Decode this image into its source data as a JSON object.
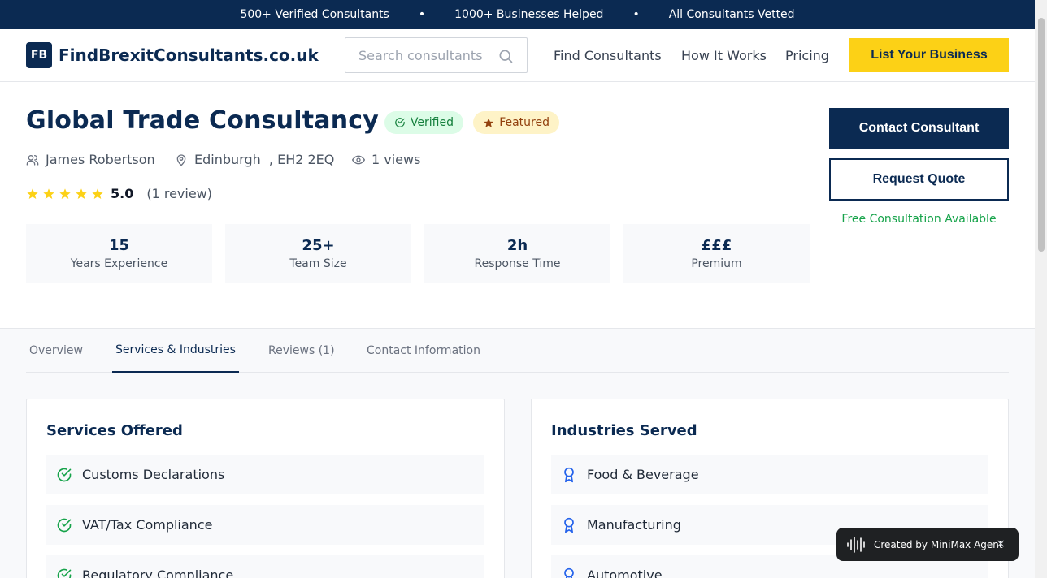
{
  "topbar": {
    "items": [
      "500+ Verified Consultants",
      "1000+ Businesses Helped",
      "All Consultants Vetted"
    ],
    "separator": "•"
  },
  "header": {
    "logo_badge": "FB",
    "logo_text": "FindBrexitConsultants.co.uk",
    "search_placeholder": "Search consultants",
    "nav": [
      "Find Consultants",
      "How It Works",
      "Pricing"
    ],
    "cta": "List Your Business"
  },
  "profile": {
    "name": "Global Trade Consultancy",
    "badge_verified": "Verified",
    "badge_featured": "Featured",
    "person": "James Robertson",
    "location": "Edinburgh  , EH2 2EQ",
    "views": "1 views",
    "rating": "5.0",
    "rating_stars": 5,
    "review_count": "(1 review)"
  },
  "stats": [
    {
      "value": "15",
      "label": "Years Experience"
    },
    {
      "value": "25+",
      "label": "Team Size"
    },
    {
      "value": "2h",
      "label": "Response Time"
    },
    {
      "value": "£££",
      "label": "Premium"
    }
  ],
  "actions": {
    "contact": "Contact Consultant",
    "quote": "Request Quote",
    "free_consultation": "Free Consultation Available"
  },
  "tabs": [
    {
      "label": "Overview",
      "active": false
    },
    {
      "label": "Services & Industries",
      "active": true
    },
    {
      "label": "Reviews (1)",
      "active": false
    },
    {
      "label": "Contact Information",
      "active": false
    }
  ],
  "services": {
    "title": "Services Offered",
    "items": [
      "Customs Declarations",
      "VAT/Tax Compliance",
      "Regulatory Compliance"
    ]
  },
  "industries": {
    "title": "Industries Served",
    "items": [
      "Food & Beverage",
      "Manufacturing",
      "Automotive"
    ]
  },
  "toast": {
    "text": "Created by MiniMax Agent",
    "close": "×"
  },
  "colors": {
    "navy": "#0b2a52",
    "yellow": "#fcd116",
    "green": "#16a34a",
    "star": "#fcd116"
  },
  "icons": {
    "search": "search-icon",
    "verified": "check-circle-icon",
    "featured": "star-icon",
    "person": "user-icon",
    "location": "map-pin-icon",
    "views": "eye-icon",
    "service_item": "check-circle-icon",
    "industry_item": "award-icon",
    "toast": "waveform-icon"
  }
}
